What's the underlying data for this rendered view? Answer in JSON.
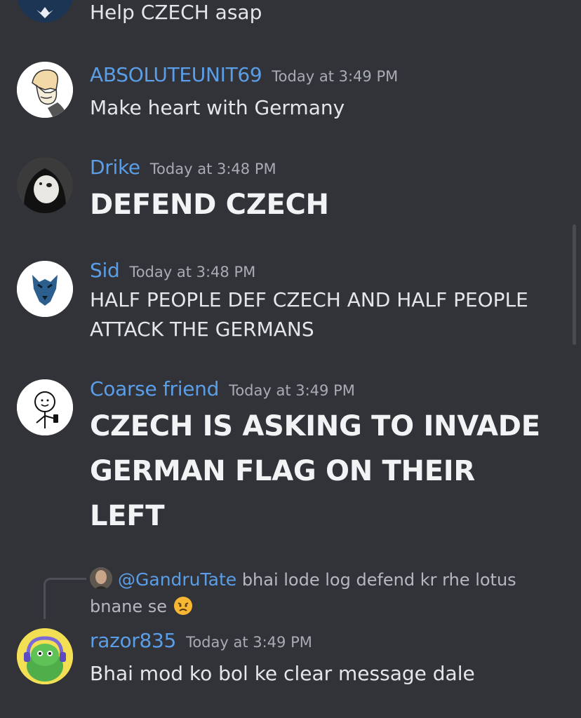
{
  "messages": [
    {
      "id": "partial",
      "author": "",
      "time": "",
      "text": "Help CZECH asap"
    },
    {
      "id": "m1",
      "author": "ABSOLUTEUNIT69",
      "time": "Today at 3:49 PM",
      "text": "Make heart with Germany"
    },
    {
      "id": "m2",
      "author": "Drike",
      "time": "Today at 3:48 PM",
      "text": "DEFEND CZECH"
    },
    {
      "id": "m3",
      "author": "Sid",
      "time": "Today at 3:48 PM",
      "text": "HALF PEOPLE DEF CZECH AND HALF PEOPLE ATTACK THE GERMANS"
    },
    {
      "id": "m4",
      "author": "Coarse friend",
      "time": "Today at 3:49 PM",
      "text": "CZECH IS ASKING TO INVADE GERMAN FLAG ON THEIR LEFT"
    },
    {
      "id": "m5",
      "author": "razor835",
      "time": "Today at 3:49 PM",
      "text": "Bhai mod ko bol ke clear message dale",
      "reply": {
        "mention": "@GandruTate",
        "text": "bhai lode log defend kr rhe lotus bnane se",
        "emoji": "angry-face-emoji"
      }
    }
  ],
  "colors": {
    "background": "#313338",
    "username": "#5b9ee8",
    "timestamp": "#a8acb3",
    "text": "#e4e6e9"
  }
}
